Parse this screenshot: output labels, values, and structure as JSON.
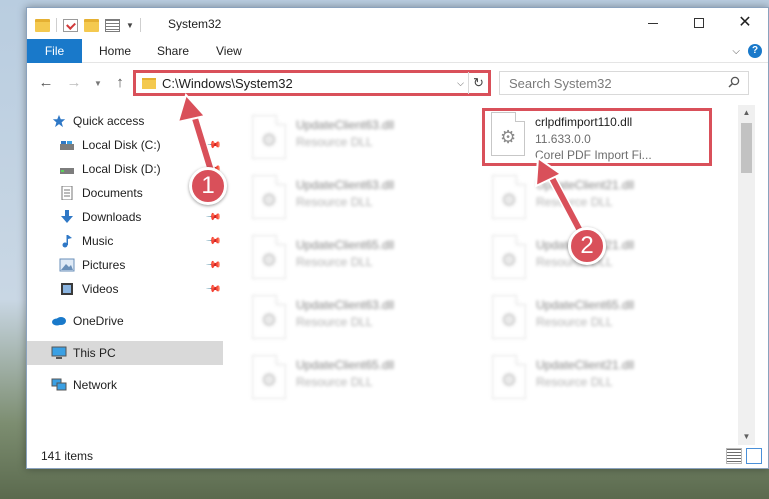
{
  "window": {
    "title": "System32",
    "quick_access_icons": [
      "folder-icon",
      "properties-icon",
      "new-folder-icon",
      "view-icon"
    ]
  },
  "ribbon": {
    "tabs": [
      {
        "label": "File"
      },
      {
        "label": "Home"
      },
      {
        "label": "Share"
      },
      {
        "label": "View"
      }
    ]
  },
  "address": {
    "path": "C:\\Windows\\System32",
    "search_placeholder": "Search System32"
  },
  "nav": {
    "items": [
      {
        "label": "Quick access",
        "icon": "star-icon",
        "pinned": false
      },
      {
        "label": "Local Disk (C:)",
        "icon": "drive-icon",
        "pinned": true
      },
      {
        "label": "Local Disk (D:)",
        "icon": "drive-icon",
        "pinned": true
      },
      {
        "label": "Documents",
        "icon": "documents-icon",
        "pinned": true
      },
      {
        "label": "Downloads",
        "icon": "download-icon",
        "pinned": true
      },
      {
        "label": "Music",
        "icon": "music-icon",
        "pinned": true
      },
      {
        "label": "Pictures",
        "icon": "pictures-icon",
        "pinned": true
      },
      {
        "label": "Videos",
        "icon": "videos-icon",
        "pinned": true
      },
      {
        "label": "OneDrive",
        "icon": "cloud-icon",
        "pinned": false
      },
      {
        "label": "This PC",
        "icon": "computer-icon",
        "pinned": false,
        "selected": true
      },
      {
        "label": "Network",
        "icon": "network-icon",
        "pinned": false
      }
    ]
  },
  "files": {
    "highlighted": {
      "name": "crlpdfimport110.dll",
      "version": "11.633.0.0",
      "description": "Corel PDF Import Fi..."
    },
    "blurred": [
      {
        "name": "UpdateClient63.dll",
        "type": "Resource DLL"
      },
      {
        "name": "UpdateClient63.dll",
        "type": "Resource DLL"
      },
      {
        "name": "UpdateClient21.dll",
        "type": "Resource DLL"
      },
      {
        "name": "UpdateClient65.dll",
        "type": "Resource DLL"
      },
      {
        "name": "UpdateClient21.dll",
        "type": "Resource DLL"
      },
      {
        "name": "UpdateClient63.dll",
        "type": "Resource DLL"
      },
      {
        "name": "UpdateClient65.dll",
        "type": "Resource DLL"
      },
      {
        "name": "UpdateClient65.dll",
        "type": "Resource DLL"
      },
      {
        "name": "UpdateClient21.dll",
        "type": "Resource DLL"
      }
    ]
  },
  "status": {
    "item_count": "141 items"
  },
  "annotations": {
    "step1": "1",
    "step2": "2",
    "color": "#d9505a"
  }
}
